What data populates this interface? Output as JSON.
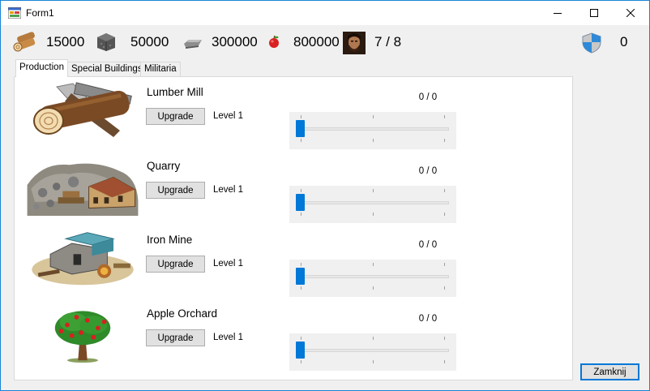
{
  "window": {
    "title": "Form1"
  },
  "resources": {
    "wood": "15000",
    "stone": "50000",
    "iron": "300000",
    "food": "800000",
    "population": "7 / 8",
    "defense": "0"
  },
  "tabs": [
    {
      "label": "Production"
    },
    {
      "label": "Special Buildings"
    },
    {
      "label": "Militaria"
    }
  ],
  "buildings": [
    {
      "name": "Lumber Mill",
      "button": "Upgrade",
      "level": "Level 1",
      "count": "0 / 0",
      "slider_value": 0
    },
    {
      "name": "Quarry",
      "button": "Upgrade",
      "level": "Level 1",
      "count": "0 / 0",
      "slider_value": 0
    },
    {
      "name": "Iron Mine",
      "button": "Upgrade",
      "level": "Level 1",
      "count": "0 / 0",
      "slider_value": 0
    },
    {
      "name": "Apple Orchard",
      "button": "Upgrade",
      "level": "Level 1",
      "count": "0 / 0",
      "slider_value": 0
    }
  ],
  "close_button": "Zamknij",
  "icons": {
    "app": "form-app-icon",
    "wood": "wood-logs-icon",
    "stone": "stone-block-icon",
    "iron": "iron-ingot-icon",
    "food": "apple-icon",
    "population": "worker-portrait-icon",
    "defense": "shield-icon"
  },
  "colors": {
    "accent": "#0078d7",
    "window_border": "#1883d7"
  }
}
